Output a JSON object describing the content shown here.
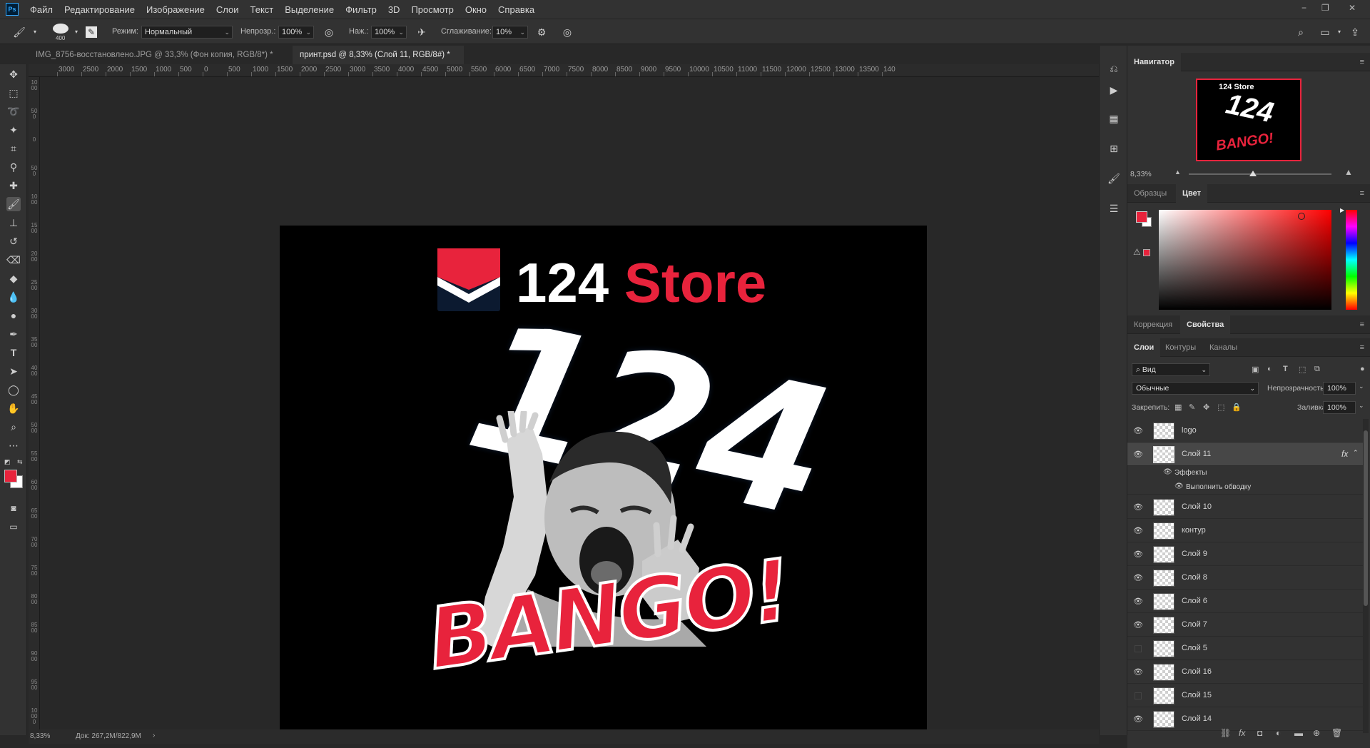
{
  "menubar": {
    "app_logo": "Ps",
    "items": [
      "Файл",
      "Редактирование",
      "Изображение",
      "Слои",
      "Текст",
      "Выделение",
      "Фильтр",
      "3D",
      "Просмотр",
      "Окно",
      "Справка"
    ],
    "window_controls": [
      "−",
      "❐",
      "✕"
    ]
  },
  "options": {
    "brush_size": "400",
    "mode_label": "Режим:",
    "mode_value": "Нормальный",
    "opacity_label": "Непрозр.:",
    "opacity_value": "100%",
    "flow_label": "Наж.:",
    "flow_value": "100%",
    "smoothing_label": "Сглаживание:",
    "smoothing_value": "10%"
  },
  "tabs": [
    {
      "label": "IMG_8756-восстановлено.JPG @ 33,3% (Фон копия, RGB/8*) *",
      "close": "×",
      "active": false
    },
    {
      "label": "принт.psd @ 8,33% (Слой 11, RGB/8#) *",
      "close": "×",
      "active": true
    }
  ],
  "ruler_top": [
    "3000",
    "2500",
    "2000",
    "1500",
    "1000",
    "500",
    "0",
    "500",
    "1000",
    "1500",
    "2000",
    "2500",
    "3000",
    "3500",
    "4000",
    "4500",
    "5000",
    "5500",
    "6000",
    "6500",
    "7000",
    "7500",
    "8000",
    "8500",
    "9000",
    "9500",
    "10000",
    "10500",
    "11000",
    "11500",
    "12000",
    "12500",
    "13000",
    "13500",
    "140"
  ],
  "ruler_left": [
    "1000",
    "500",
    "0",
    "500",
    "1000",
    "1500",
    "2000",
    "2500",
    "3000",
    "3500",
    "4000",
    "4500",
    "5000",
    "5500",
    "6000",
    "6500",
    "7000",
    "7500",
    "8000",
    "8500",
    "9000",
    "9500",
    "10000"
  ],
  "artwork": {
    "brand_number": "124",
    "brand_word": "Store",
    "big_number": "124",
    "bango": "BANGO!"
  },
  "status": {
    "zoom": "8,33%",
    "doc": "Док: 267,2M/822,9M",
    "arrow": "›"
  },
  "navigator": {
    "title": "Навигатор",
    "menu": "≡",
    "zoom": "8,33%",
    "slider_value": 0.45,
    "thumb_text": "124 Store",
    "thumb_number": "124",
    "thumb_bango": "BANGO!"
  },
  "color_panel": {
    "tabs": [
      "Образцы",
      "Цвет"
    ],
    "active_tab": "Цвет",
    "menu": "≡",
    "fg_color": "#e8233c",
    "bg_color": "#ffffff",
    "warning": "⚠"
  },
  "adjust_panel": {
    "tabs": [
      "Коррекция",
      "Свойства"
    ],
    "active_tab": "Свойства",
    "menu": "≡"
  },
  "layers_panel": {
    "tabs": [
      "Слои",
      "Контуры",
      "Каналы"
    ],
    "active_tab": "Слои",
    "menu": "≡",
    "filter_label": "Вид",
    "blend_mode": "Обычные",
    "opacity_label": "Непрозрачность:",
    "opacity_value": "100%",
    "lock_label": "Закрепить:",
    "fill_label": "Заливка:",
    "fill_value": "100%",
    "fx_label": "fx",
    "effects_label": "Эффекты",
    "stroke_effect_label": "Выполнить обводку",
    "layers": [
      {
        "name": "logo",
        "visible": true
      },
      {
        "name": "Слой 11",
        "visible": true,
        "selected": true
      },
      {
        "name": "Слой 10",
        "visible": true
      },
      {
        "name": "контур",
        "visible": true
      },
      {
        "name": "Слой 9",
        "visible": true
      },
      {
        "name": "Слой 8",
        "visible": true
      },
      {
        "name": "Слой 6",
        "visible": true
      },
      {
        "name": "Слой 7",
        "visible": true
      },
      {
        "name": "Слой 5",
        "visible": false
      },
      {
        "name": "Слой 16",
        "visible": true
      },
      {
        "name": "Слой 15",
        "visible": false
      },
      {
        "name": "Слой 14",
        "visible": true
      }
    ]
  },
  "colors": {
    "accent_red": "#e8233c",
    "logo_navy": "#0c1a30"
  }
}
